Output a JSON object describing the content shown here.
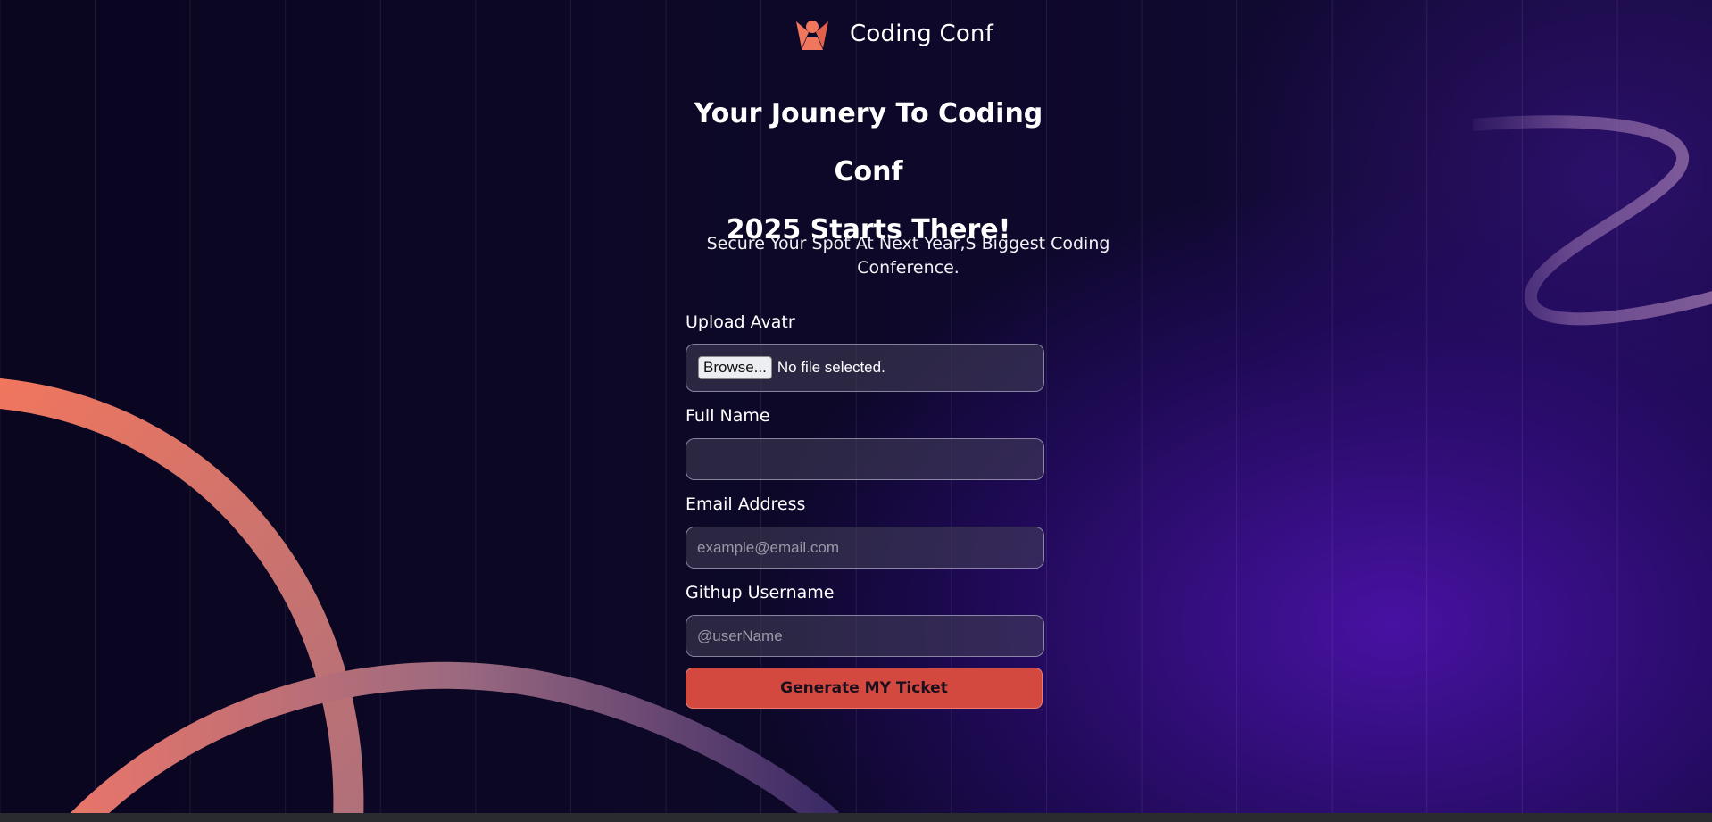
{
  "brand": {
    "name": "Coding Conf",
    "logo_icon": "conference-logo-icon",
    "logo_color": "#f0765e"
  },
  "hero": {
    "title_line1": "Your Jounery To Coding Conf",
    "title_line2": "2025 Starts There!",
    "subtitle": "Secure Your Spot At Next Year,S Biggest Coding Conference."
  },
  "form": {
    "avatar": {
      "label": "Upload Avatr",
      "browse_label": "Browse...",
      "status": "No file selected."
    },
    "full_name": {
      "label": "Full Name",
      "value": "",
      "placeholder": ""
    },
    "email": {
      "label": "Email Address",
      "placeholder": "example@email.com"
    },
    "github": {
      "label": "Githup Username",
      "placeholder": "@userName"
    },
    "submit_label": "Generate MY Ticket"
  },
  "colors": {
    "accent": "#d4493f",
    "background": "#0b0620",
    "purple_glow": "#4a12a8"
  }
}
